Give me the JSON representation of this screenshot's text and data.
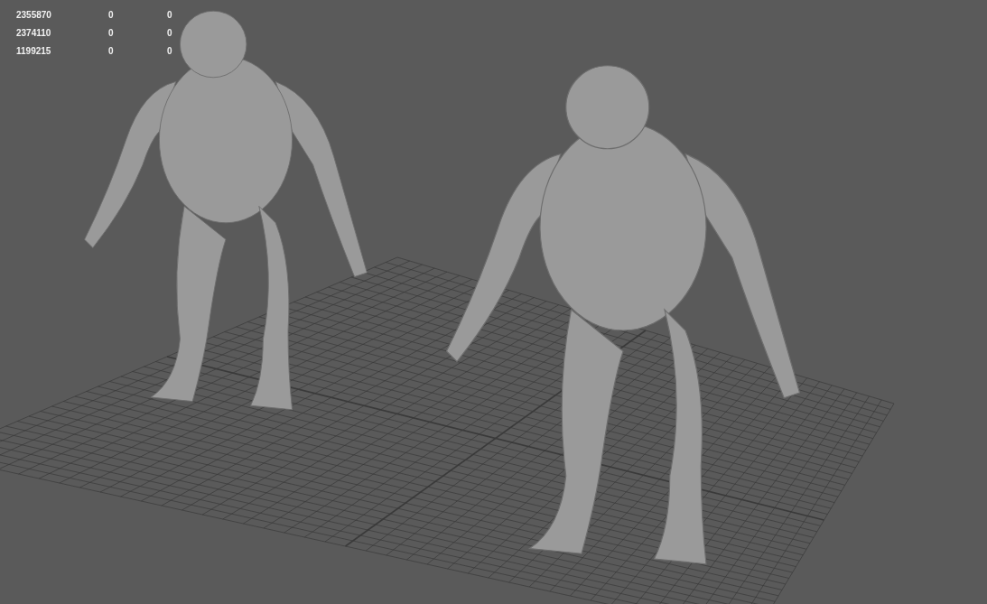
{
  "hud": {
    "rows": [
      {
        "values": [
          "2355870",
          "0",
          "0"
        ]
      },
      {
        "values": [
          "2374110",
          "0",
          "0"
        ]
      },
      {
        "values": [
          "1199215",
          "0",
          "0"
        ]
      }
    ]
  }
}
